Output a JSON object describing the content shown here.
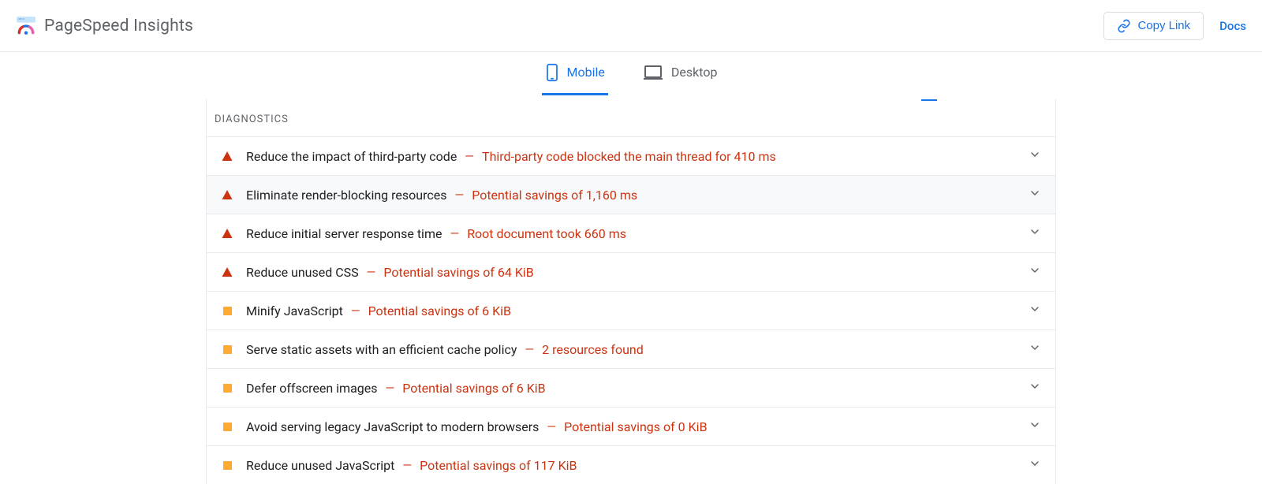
{
  "header": {
    "title": "PageSpeed Insights",
    "copy_link_label": "Copy Link",
    "docs_label": "Docs"
  },
  "tabs": {
    "mobile": "Mobile",
    "desktop": "Desktop",
    "active": "mobile"
  },
  "section": {
    "heading": "DIAGNOSTICS"
  },
  "diagnostics": [
    {
      "severity": "fail",
      "label": "Reduce the impact of third-party code",
      "detail": "Third-party code blocked the main thread for 410 ms",
      "hovered": false
    },
    {
      "severity": "fail",
      "label": "Eliminate render-blocking resources",
      "detail": "Potential savings of 1,160 ms",
      "hovered": true
    },
    {
      "severity": "fail",
      "label": "Reduce initial server response time",
      "detail": "Root document took 660 ms",
      "hovered": false
    },
    {
      "severity": "fail",
      "label": "Reduce unused CSS",
      "detail": "Potential savings of 64 KiB",
      "hovered": false
    },
    {
      "severity": "warn",
      "label": "Minify JavaScript",
      "detail": "Potential savings of 6 KiB",
      "hovered": false
    },
    {
      "severity": "warn",
      "label": "Serve static assets with an efficient cache policy",
      "detail": "2 resources found",
      "hovered": false
    },
    {
      "severity": "warn",
      "label": "Defer offscreen images",
      "detail": "Potential savings of 6 KiB",
      "hovered": false
    },
    {
      "severity": "warn",
      "label": "Avoid serving legacy JavaScript to modern browsers",
      "detail": "Potential savings of 0 KiB",
      "hovered": false
    },
    {
      "severity": "warn",
      "label": "Reduce unused JavaScript",
      "detail": "Potential savings of 117 KiB",
      "hovered": false
    }
  ]
}
